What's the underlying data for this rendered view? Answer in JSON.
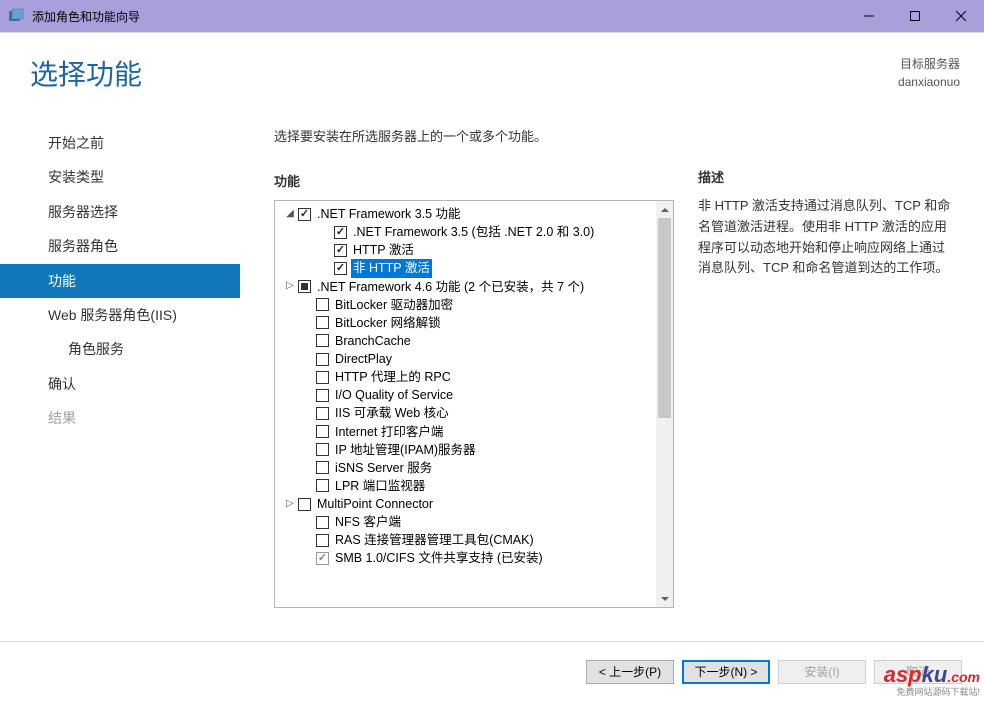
{
  "window": {
    "title": "添加角色和功能向导"
  },
  "header": {
    "page_title": "选择功能",
    "target_label": "目标服务器",
    "target_name": "danxiaonuo"
  },
  "sidebar": {
    "items": [
      {
        "label": "开始之前",
        "state": "normal"
      },
      {
        "label": "安装类型",
        "state": "normal"
      },
      {
        "label": "服务器选择",
        "state": "normal"
      },
      {
        "label": "服务器角色",
        "state": "normal"
      },
      {
        "label": "功能",
        "state": "active"
      },
      {
        "label": "Web 服务器角色(IIS)",
        "state": "normal"
      },
      {
        "label": "角色服务",
        "state": "normal",
        "indent": true
      },
      {
        "label": "确认",
        "state": "normal"
      },
      {
        "label": "结果",
        "state": "disabled"
      }
    ]
  },
  "main": {
    "instruction": "选择要安装在所选服务器上的一个或多个功能。",
    "features_label": "功能",
    "description_label": "描述",
    "description_text": "非 HTTP 激活支持通过消息队列、TCP 和命名管道激活进程。使用非 HTTP 激活的应用程序可以动态地开始和停止响应网络上通过消息队列、TCP 和命名管道到达的工作项。",
    "tree": [
      {
        "level": 1,
        "expander": "down",
        "check": "checked",
        "label": ".NET Framework 3.5 功能"
      },
      {
        "level": 3,
        "expander": "",
        "check": "checked",
        "label": ".NET Framework 3.5 (包括 .NET 2.0 和 3.0)"
      },
      {
        "level": 3,
        "expander": "",
        "check": "checked",
        "label": "HTTP 激活"
      },
      {
        "level": 3,
        "expander": "",
        "check": "checked",
        "label": "非 HTTP 激活",
        "selected": true
      },
      {
        "level": 1,
        "expander": "right",
        "check": "indet",
        "label": ".NET Framework 4.6 功能 (2 个已安装，共 7 个)"
      },
      {
        "level": 2,
        "expander": "",
        "check": "unchecked",
        "label": "BitLocker 驱动器加密"
      },
      {
        "level": 2,
        "expander": "",
        "check": "unchecked",
        "label": "BitLocker 网络解锁"
      },
      {
        "level": 2,
        "expander": "",
        "check": "unchecked",
        "label": "BranchCache"
      },
      {
        "level": 2,
        "expander": "",
        "check": "unchecked",
        "label": "DirectPlay"
      },
      {
        "level": 2,
        "expander": "",
        "check": "unchecked",
        "label": "HTTP 代理上的 RPC"
      },
      {
        "level": 2,
        "expander": "",
        "check": "unchecked",
        "label": "I/O Quality of Service"
      },
      {
        "level": 2,
        "expander": "",
        "check": "unchecked",
        "label": "IIS 可承载 Web 核心"
      },
      {
        "level": 2,
        "expander": "",
        "check": "unchecked",
        "label": "Internet 打印客户端"
      },
      {
        "level": 2,
        "expander": "",
        "check": "unchecked",
        "label": "IP 地址管理(IPAM)服务器"
      },
      {
        "level": 2,
        "expander": "",
        "check": "unchecked",
        "label": "iSNS Server 服务"
      },
      {
        "level": 2,
        "expander": "",
        "check": "unchecked",
        "label": "LPR 端口监视器"
      },
      {
        "level": 1,
        "expander": "right",
        "check": "unchecked",
        "label": "MultiPoint Connector"
      },
      {
        "level": 2,
        "expander": "",
        "check": "unchecked",
        "label": "NFS 客户端"
      },
      {
        "level": 2,
        "expander": "",
        "check": "unchecked",
        "label": "RAS 连接管理器管理工具包(CMAK)"
      },
      {
        "level": 2,
        "expander": "",
        "check": "checked-dim",
        "label": "SMB 1.0/CIFS 文件共享支持 (已安装)"
      }
    ]
  },
  "footer": {
    "prev": "< 上一步(P)",
    "next": "下一步(N) >",
    "install": "安装(I)",
    "cancel": "取消"
  },
  "watermark": {
    "text1": "asp",
    "text2": "ku",
    "ext": ".com",
    "sub": "免费网站源码下载站!"
  }
}
